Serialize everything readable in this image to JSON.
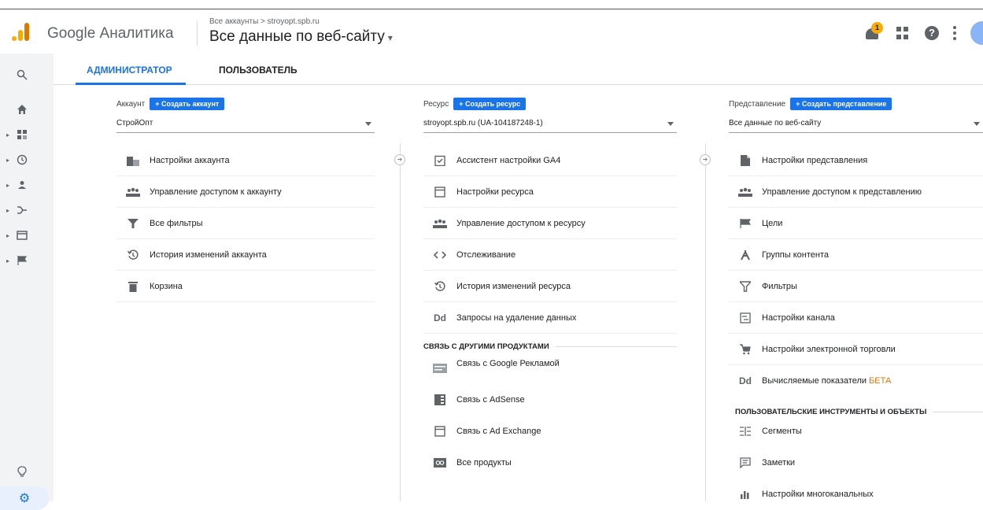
{
  "header": {
    "app_title": "Google Аналитика",
    "breadcrumb": "Все аккаунты > stroyopt.spb.ru",
    "view_title": "Все данные по веб-сайту",
    "notification_count": "1",
    "help_glyph": "?"
  },
  "tabs": [
    {
      "label": "АДМИНИСТРАТОР",
      "active": true
    },
    {
      "label": "ПОЛЬЗОВАТЕЛЬ",
      "active": false
    }
  ],
  "sidebar": {
    "icons": [
      "search-icon",
      "home-icon",
      "dashboard-icon",
      "clock-icon",
      "person-icon",
      "acquisition-icon",
      "behavior-icon",
      "flag-icon",
      "lightbulb-icon",
      "gear-icon"
    ]
  },
  "account": {
    "label": "Аккаунт",
    "create_label": "+  Создать аккаунт",
    "selected": "СтройОпт",
    "items": [
      {
        "label": "Настройки аккаунта",
        "icon": "building-icon"
      },
      {
        "label": "Управление доступом к аккаунту",
        "icon": "people-icon"
      },
      {
        "label": "Все фильтры",
        "icon": "filter-icon"
      },
      {
        "label": "История изменений аккаунта",
        "icon": "history-icon"
      },
      {
        "label": "Корзина",
        "icon": "trash-icon"
      }
    ]
  },
  "property": {
    "label": "Ресурс",
    "create_label": "+  Создать ресурс",
    "selected": "stroyopt.spb.ru (UA-104187248-1)",
    "items": [
      {
        "label": "Ассистент настройки GA4",
        "icon": "checklist-icon"
      },
      {
        "label": "Настройки ресурса",
        "icon": "window-icon"
      },
      {
        "label": "Управление доступом к ресурсу",
        "icon": "people-icon"
      },
      {
        "label": "Отслеживание",
        "icon": "code-icon"
      },
      {
        "label": "История изменений ресурса",
        "icon": "history-icon"
      },
      {
        "label": "Запросы на удаление данных",
        "icon": "dd-icon"
      }
    ],
    "section_title": "СВЯЗЬ С ДРУГИМИ ПРОДУКТАМИ",
    "section_items": [
      {
        "label": "Связь с Google Рекламой",
        "icon": "ads-icon"
      },
      {
        "label": "Связь с AdSense",
        "icon": "adsense-icon"
      },
      {
        "label": "Связь с Ad Exchange",
        "icon": "adexchange-icon"
      },
      {
        "label": "Все продукты",
        "icon": "link-icon"
      }
    ]
  },
  "view": {
    "label": "Представление",
    "create_label": "+  Создать представление",
    "selected": "Все данные по веб-сайту",
    "items": [
      {
        "label": "Настройки представления",
        "icon": "document-icon"
      },
      {
        "label": "Управление доступом к представлению",
        "icon": "people-icon"
      },
      {
        "label": "Цели",
        "icon": "flag-icon"
      },
      {
        "label": "Группы контента",
        "icon": "content-group-icon"
      },
      {
        "label": "Фильтры",
        "icon": "filter-icon"
      },
      {
        "label": "Настройки канала",
        "icon": "channel-icon"
      },
      {
        "label": "Настройки электронной торговли",
        "icon": "cart-icon"
      },
      {
        "label": "Вычисляемые показатели",
        "badge": "БЕТА",
        "icon": "dd-icon"
      }
    ],
    "section_title": "ПОЛЬЗОВАТЕЛЬСКИЕ ИНСТРУМЕНТЫ И ОБЪЕКТЫ",
    "section_items": [
      {
        "label": "Сегменты",
        "icon": "segments-icon"
      },
      {
        "label": "Заметки",
        "icon": "notes-icon"
      },
      {
        "label": "Настройки многоканальных",
        "icon": "bar-chart-icon"
      }
    ]
  },
  "colors": {
    "accent": "#1a73e8",
    "brand_orange": "#f9ab00",
    "beta": "#e37400"
  }
}
